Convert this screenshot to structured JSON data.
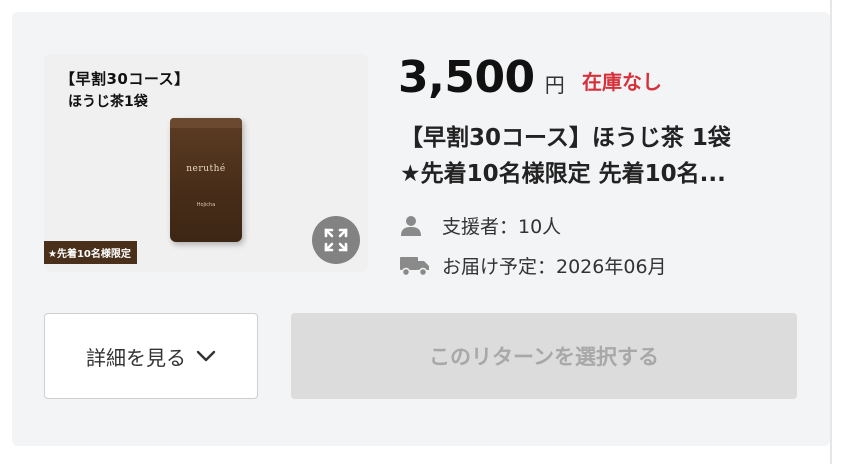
{
  "reward": {
    "price": "3,500",
    "currency": "円",
    "stock_status": "在庫なし",
    "title_line1": "【早割30コース】ほうじ茶 1袋",
    "title_line2": "★先着10名様限定 先着10名...",
    "supporters": "支援者：10人",
    "delivery": "お届け予定：2026年06月",
    "colors": {
      "stock": "#d6303a",
      "card_bg": "#f3f4f6",
      "disabled_button_bg": "#dcdcdc"
    }
  },
  "thumbnail": {
    "label_line1": "【早割30コース】",
    "label_line2": "ほうじ茶1袋",
    "badge": "★先着10名様限定",
    "brand": "neruthé",
    "product": "Hojicha",
    "expand_icon": "expand-arrows-icon"
  },
  "actions": {
    "detail_label": "詳細を見る",
    "select_label": "このリターンを選択する"
  },
  "icons": {
    "supporters": "person-icon",
    "delivery": "truck-icon",
    "detail_chevron": "chevron-down-icon"
  }
}
